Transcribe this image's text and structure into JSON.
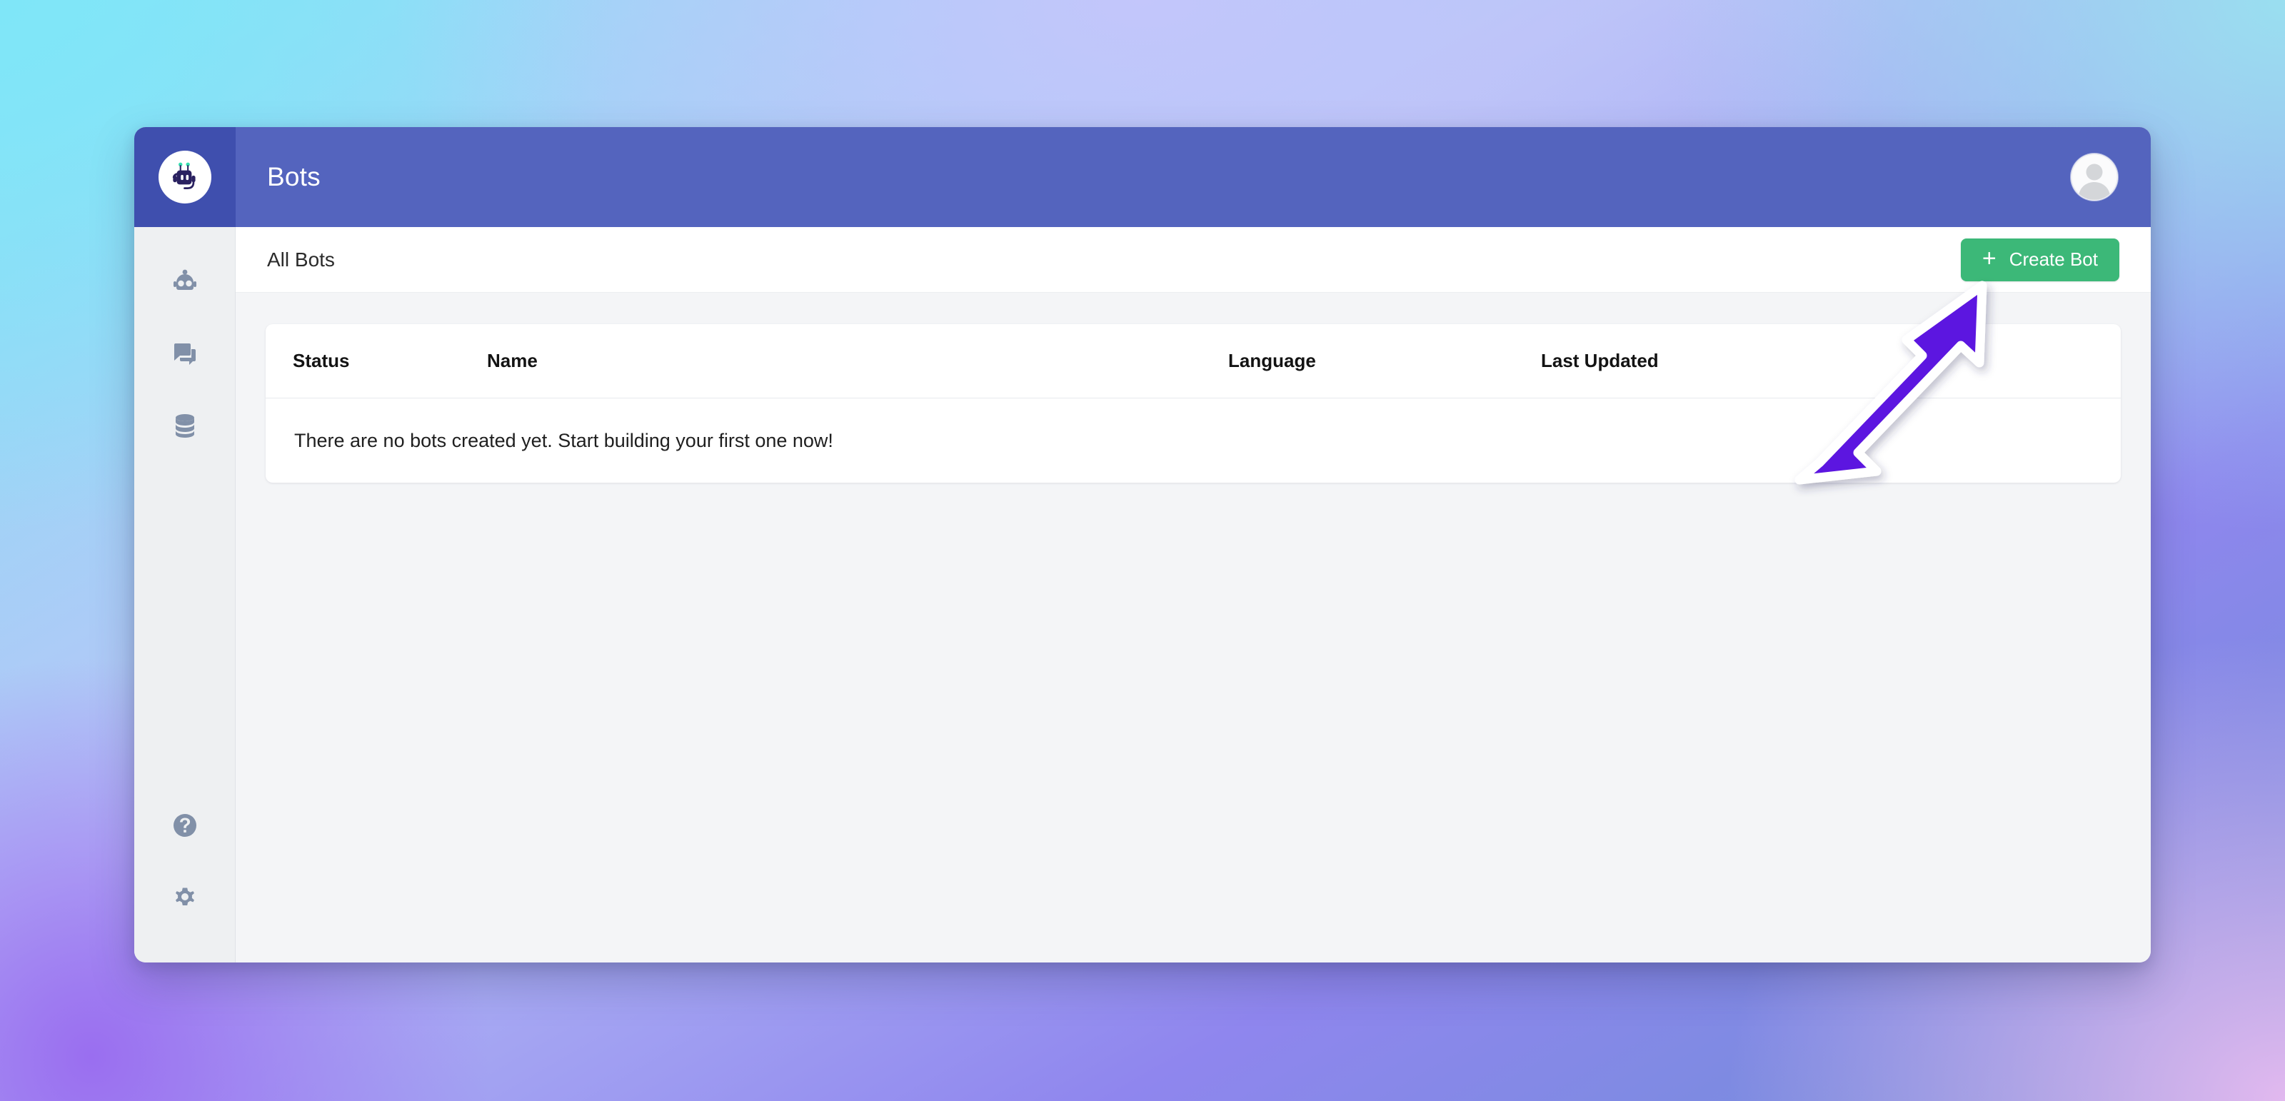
{
  "window": {
    "brand": {
      "logo_icon": "robot-headset-logo"
    },
    "header": {
      "title": "Bots",
      "avatar_icon": "user-avatar-icon"
    }
  },
  "sidebar": {
    "top_items": [
      {
        "icon": "bot-icon",
        "name": "bots"
      },
      {
        "icon": "chat-bubbles-icon",
        "name": "conversations"
      },
      {
        "icon": "database-icon",
        "name": "data"
      }
    ],
    "bottom_items": [
      {
        "icon": "help-circle-icon",
        "name": "help"
      },
      {
        "icon": "gear-icon",
        "name": "settings"
      }
    ]
  },
  "toolbar": {
    "all_bots_label": "All Bots",
    "create_bot_label": "Create Bot",
    "create_bot_plus": "+"
  },
  "table": {
    "columns": [
      {
        "key": "status",
        "label": "Status"
      },
      {
        "key": "name",
        "label": "Name"
      },
      {
        "key": "language",
        "label": "Language"
      },
      {
        "key": "last_updated",
        "label": "Last Updated"
      }
    ],
    "rows": [],
    "empty_message": "There are no bots created yet. Start building your first one now!"
  },
  "annotation": {
    "type": "arrow",
    "name": "arrow-pointing-to-create-bot-button",
    "points_to": "create-bot-button",
    "fill_color": "#5b12e0",
    "outline_color": "#ffffff"
  },
  "colors": {
    "header_blue": "#5464be",
    "logo_blue": "#3f4fae",
    "sidebar_gray": "#eef0f2",
    "content_gray": "#f4f5f7",
    "accent_green": "#3cb878",
    "arrow_violet": "#5b12e0"
  }
}
